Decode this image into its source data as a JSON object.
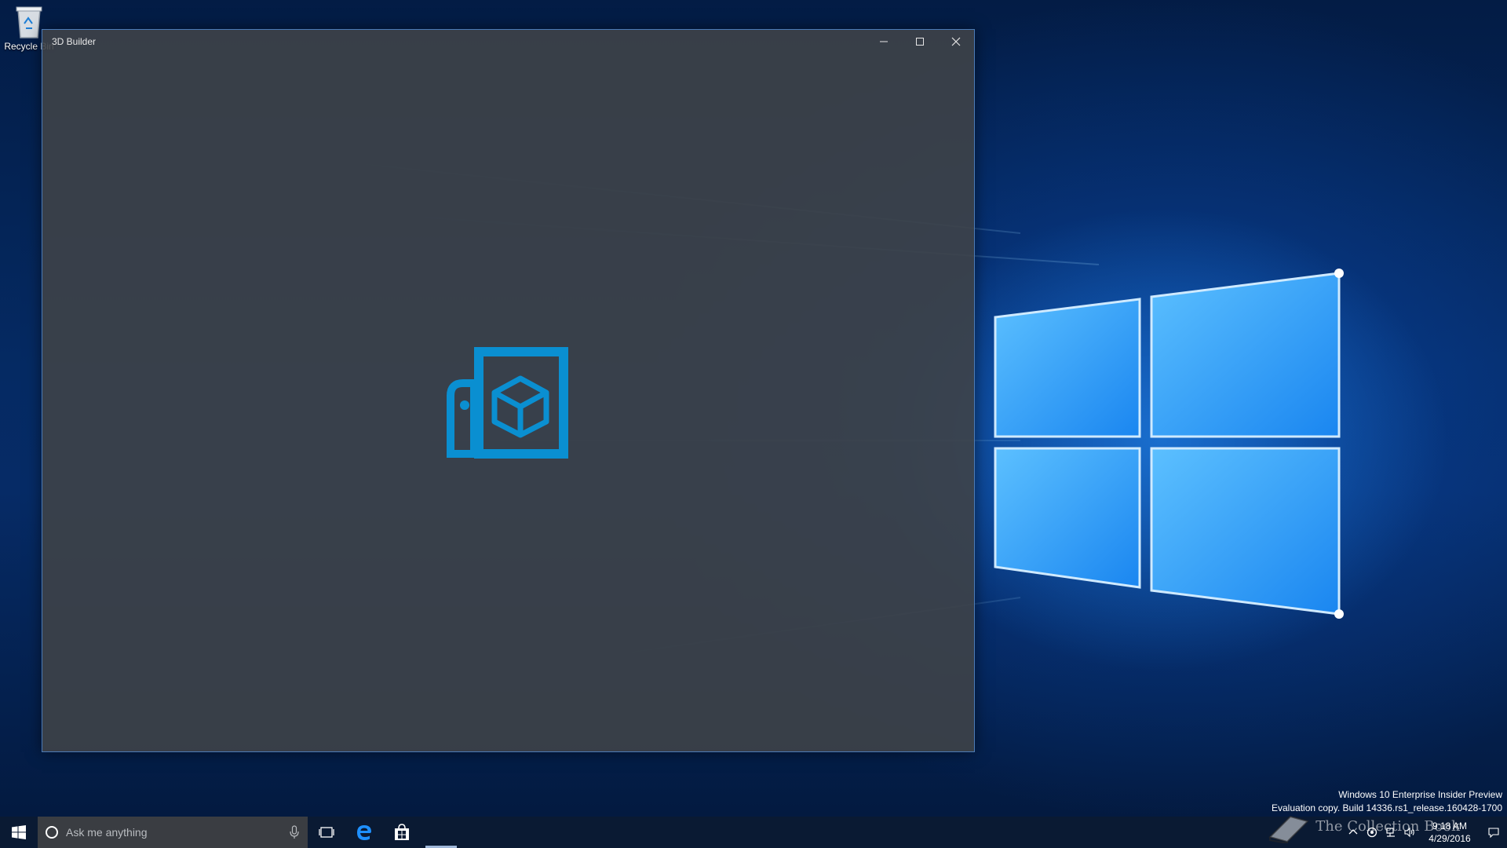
{
  "desktop": {
    "icons": [
      {
        "label": "Recycle Bin",
        "icon": "recycle-bin-icon"
      }
    ],
    "watermark": {
      "line1": "Windows 10 Enterprise Insider Preview",
      "line2": "Evaluation copy. Build 14336.rs1_release.160428-1700"
    },
    "badge_text": "The Collection Book"
  },
  "window": {
    "title": "3D Builder",
    "controls": {
      "minimize": "minimize-icon",
      "maximize": "maximize-icon",
      "close": "close-icon"
    },
    "splash_icon": "3d-builder-logo-icon",
    "accent_color": "#0a8fd1"
  },
  "taskbar": {
    "search_placeholder": "Ask me anything",
    "pinned": [
      {
        "name": "task-view",
        "icon": "task-view-icon"
      },
      {
        "name": "edge",
        "icon": "edge-icon"
      },
      {
        "name": "store",
        "icon": "store-icon"
      },
      {
        "name": "3d-builder",
        "icon": "running-app-indicator"
      }
    ],
    "clock": {
      "time": "9:18 AM",
      "date": "4/29/2016"
    }
  },
  "colors": {
    "wallpaper": "#052a63",
    "taskbar": "#0a1a33",
    "window_bg": "#3e4248",
    "window_border": "#4b7bb7"
  }
}
